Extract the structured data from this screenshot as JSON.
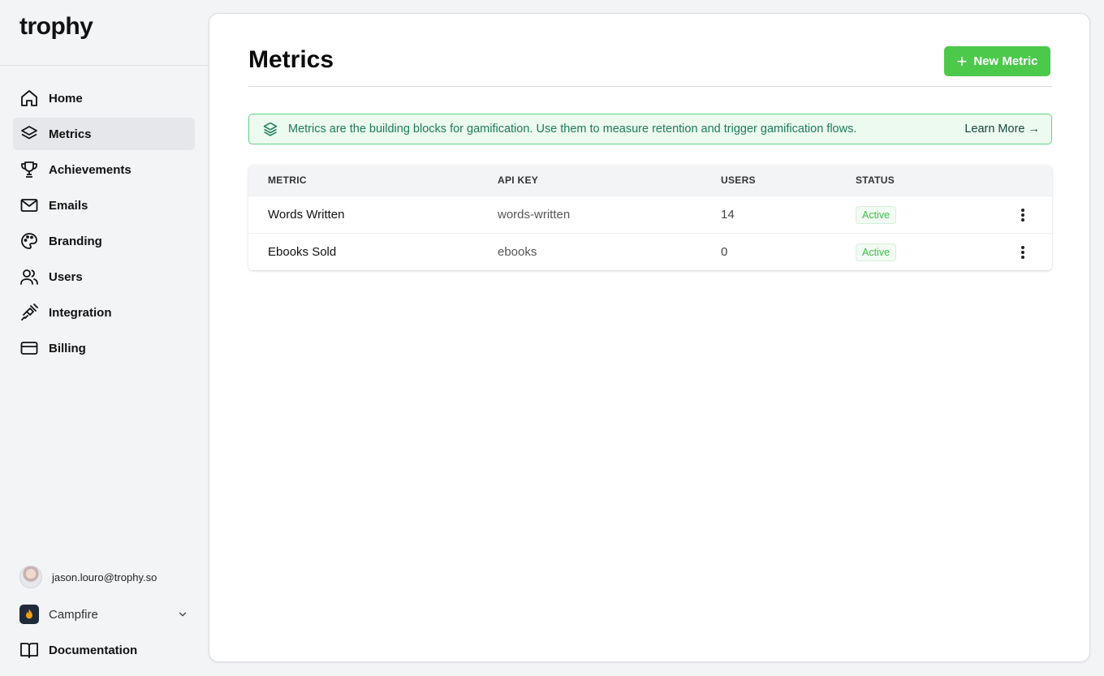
{
  "app": {
    "logo": "trophy"
  },
  "sidebar": {
    "items": [
      {
        "label": "Home",
        "icon": "home-icon"
      },
      {
        "label": "Metrics",
        "icon": "layers-icon",
        "active": true
      },
      {
        "label": "Achievements",
        "icon": "trophy-icon"
      },
      {
        "label": "Emails",
        "icon": "mail-icon"
      },
      {
        "label": "Branding",
        "icon": "palette-icon"
      },
      {
        "label": "Users",
        "icon": "users-icon"
      },
      {
        "label": "Integration",
        "icon": "plug-icon"
      },
      {
        "label": "Billing",
        "icon": "credit-card-icon"
      }
    ],
    "user_email": "jason.louro@trophy.so",
    "org_name": "Campfire",
    "documentation_label": "Documentation"
  },
  "main": {
    "title": "Metrics",
    "new_button_label": "New Metric",
    "banner": {
      "text": "Metrics are the building blocks for gamification. Use them to measure retention and trigger gamification flows.",
      "link": "Learn More →"
    },
    "table": {
      "columns": [
        "METRIC",
        "API KEY",
        "USERS",
        "STATUS"
      ],
      "rows": [
        {
          "metric": "Words Written",
          "api_key": "words-written",
          "users": "14",
          "status": "Active"
        },
        {
          "metric": "Ebooks Sold",
          "api_key": "ebooks",
          "users": "0",
          "status": "Active"
        }
      ]
    }
  },
  "colors": {
    "accent": "#4cc94a",
    "status_active": "#3cbf4a",
    "banner_border": "#5fd382",
    "banner_text": "#1f7a5a"
  }
}
